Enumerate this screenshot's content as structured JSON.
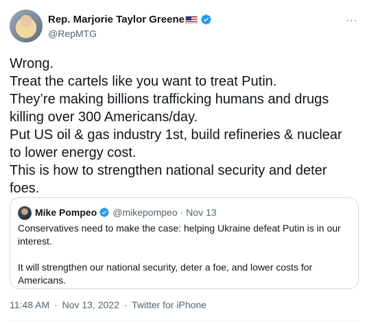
{
  "author": {
    "name": "Rep. Marjorie Taylor Greene",
    "handle": "@RepMTG",
    "icons": [
      "us-flag-icon",
      "verified-icon"
    ]
  },
  "more_menu": {
    "icon": "more-icon",
    "label": "···"
  },
  "tweet": {
    "lines": [
      "Wrong.",
      "Treat the cartels like you want to treat Putin.",
      "They’re making billions trafficking humans and drugs",
      "killing over 300 Americans/day.",
      "Put US oil & gas industry 1st, build refineries & nuclear",
      "to lower energy cost.",
      "This is how to strengthen national security and deter",
      "foes."
    ]
  },
  "quoted_tweet": {
    "name": "Mike Pompeo",
    "handle": "@mikepompeo",
    "separator": "·",
    "date": "Nov 13",
    "paragraphs": [
      "Conservatives need to make the case: helping Ukraine defeat Putin is in our interest.",
      "It will strengthen our national security, deter a foe, and lower costs for Americans."
    ]
  },
  "meta": {
    "time": "11:48 AM",
    "date": "Nov 13, 2022",
    "source": "Twitter for iPhone",
    "separator": "·"
  },
  "colors": {
    "text": "#0f1419",
    "secondary": "#536471",
    "verified": "#1d9bf0",
    "border": "#cfd9de"
  }
}
